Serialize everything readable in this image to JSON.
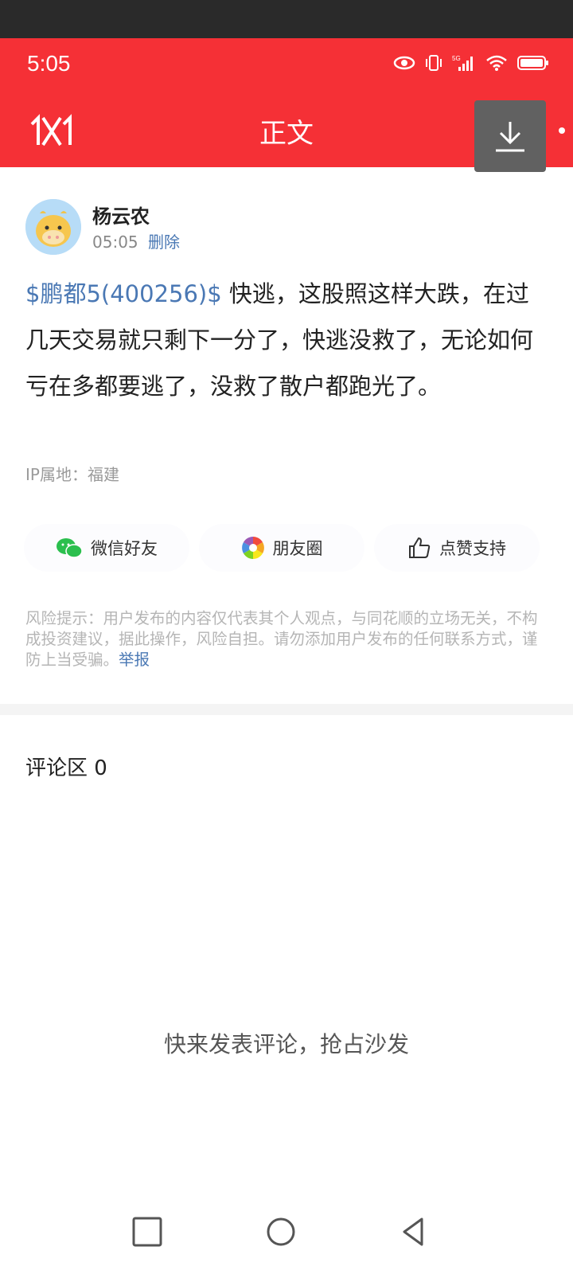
{
  "status_bar": {
    "time": "5:05",
    "icons": [
      "eye-icon",
      "vibrate-icon",
      "signal-5g-icon",
      "wifi-icon",
      "battery-icon"
    ]
  },
  "header": {
    "logo_text": "1X1",
    "title": "正文",
    "download_icon": "download-icon"
  },
  "post": {
    "user": {
      "name": "杨云农",
      "time": "05:05",
      "delete_label": "删除"
    },
    "stock_tag": "$鹏都5(400256)$",
    "text": " 快逃，这股照这样大跌，在过几天交易就只剩下一分了，快逃没救了，无论如何亏在多都要逃了，没救了散户都跑光了。",
    "ip_location": "IP属地：福建"
  },
  "share": {
    "wechat_friend": "微信好友",
    "moments": "朋友圈",
    "like_support": "点赞支持"
  },
  "risk_notice": {
    "text": "风险提示：用户发布的内容仅代表其个人观点，与同花顺的立场无关，不构成投资建议，据此操作，风险自担。请勿添加用户发布的任何联系方式，谨防上当受骗。",
    "report_label": "举报"
  },
  "comments": {
    "title": "评论区 0",
    "empty_text": "快来发表评论，抢占沙发"
  },
  "colors": {
    "brand_red": "#f53036",
    "link_blue": "#4a78b4"
  }
}
